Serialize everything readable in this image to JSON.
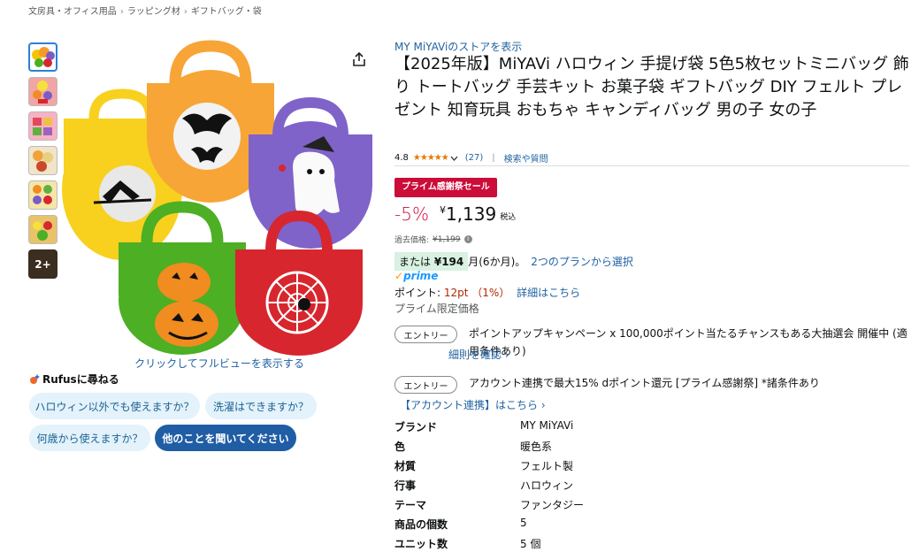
{
  "breadcrumb": [
    "文房具・オフィス用品",
    "ラッピング材",
    "ギフトバッグ・袋"
  ],
  "breadcrumb_sep": "›",
  "thumbnails": {
    "more_label": "2+"
  },
  "image": {
    "full_view_label": "クリックしてフルビューを表示する"
  },
  "rufus": {
    "title": "Rufusに尋ねる",
    "chips": [
      "ハロウィン以外でも使えますか？",
      "洗濯はできますか？",
      "何歳から使えますか？",
      "他のことを聞いてください"
    ]
  },
  "product": {
    "store_link": "MY MiYAViのストアを表示",
    "title": "【2025年版】MiYAVi ハロウィン 手提げ袋 5色5枚セットミニバッグ 飾り トートバッグ 手芸キット お菓子袋 ギフトバッグ DIY フェルト プレゼント 知育玩具 おもちゃ キャンディバッグ 男の子 女の子",
    "rating": "4.8",
    "stars": "★★★★★",
    "review_count": "(27)",
    "search_qa": "検索や質問"
  },
  "pricing": {
    "sale_badge": "プライム感謝祭セール",
    "discount": "-5%",
    "currency": "¥",
    "price": "1,139",
    "tax_label": "税込",
    "past_price_label": "過去価格:",
    "past_price": "¥1,199",
    "installment_prefix": "または",
    "installment_amount": "¥194",
    "installment_suffix": "月(6か月)。",
    "installment_link": "2つのプランから選択",
    "prime_label": "prime",
    "points_label": "ポイント:",
    "points_value": "12pt （1%）",
    "points_link": "詳細はこちら",
    "prime_only": "プライム限定価格"
  },
  "campaigns": [
    {
      "button": "エントリー",
      "text": "ポイントアップキャンペーン x 100,000ポイント当たるチャンスもある大抽選会 開催中 (適用条件あり)",
      "link": "細則を確認"
    },
    {
      "button": "エントリー",
      "text": "アカウント連携で最大15% dポイント還元 [プライム感謝祭] *諸条件あり",
      "link": "【アカウント連携】はこちら"
    }
  ],
  "specs": [
    {
      "key": "ブランド",
      "value": "MY MiYAVi"
    },
    {
      "key": "色",
      "value": "暖色系"
    },
    {
      "key": "材質",
      "value": "フェルト製"
    },
    {
      "key": "行事",
      "value": "ハロウィン"
    },
    {
      "key": "テーマ",
      "value": "ファンタジー"
    },
    {
      "key": "商品の個数",
      "value": "5"
    },
    {
      "key": "ユニット数",
      "value": "5 個"
    }
  ],
  "colors": {
    "link": "#2162a1",
    "sale": "#cc0c39",
    "price_red": "#cc0c39",
    "prime_blue": "#1a98ff",
    "chip_bg": "#e3f2fb",
    "chip_dark": "#1f5da5"
  }
}
